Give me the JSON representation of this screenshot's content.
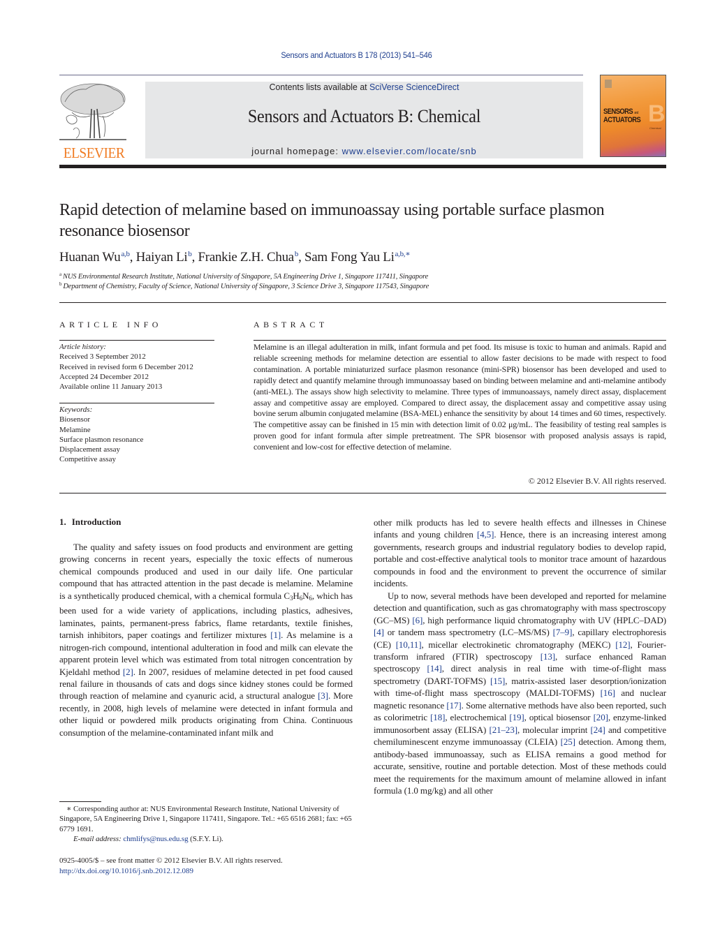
{
  "header": {
    "citation": "Sensors and Actuators B 178 (2013) 541–546",
    "contents_prefix": "Contents lists available at ",
    "contents_link": "SciVerse ScienceDirect",
    "journal_name": "Sensors and Actuators B: Chemical",
    "homepage_prefix": "journal homepage: ",
    "homepage_link": "www.elsevier.com/locate/snb",
    "publisher_logo_text": "ELSEVIER",
    "cover": {
      "line1": "SENSORS",
      "and": "and",
      "line2": "ACTUATORS",
      "letter": "B",
      "sub": "Chemical"
    }
  },
  "article": {
    "title": "Rapid detection of melamine based on immunoassay using portable surface plasmon resonance biosensor",
    "authors": [
      {
        "name": "Huanan Wu",
        "sup": "a,b"
      },
      {
        "name": "Haiyan Li",
        "sup": "b"
      },
      {
        "name": "Frankie Z.H. Chua",
        "sup": "b"
      },
      {
        "name": "Sam Fong Yau Li",
        "sup": "a,b,∗"
      }
    ],
    "affiliations": [
      {
        "key": "a",
        "text": "NUS Environmental Research Institute, National University of Singapore, 5A Engineering Drive 1, Singapore 117411, Singapore"
      },
      {
        "key": "b",
        "text": "Department of Chemistry, Faculty of Science, National University of Singapore, 3 Science Drive 3, Singapore 117543, Singapore"
      }
    ]
  },
  "article_info": {
    "heading": "ARTICLE INFO",
    "history_label": "Article history:",
    "history": [
      "Received 3 September 2012",
      "Received in revised form 6 December 2012",
      "Accepted 24 December 2012",
      "Available online 11 January 2013"
    ],
    "keywords_label": "Keywords:",
    "keywords": [
      "Biosensor",
      "Melamine",
      "Surface plasmon resonance",
      "Displacement assay",
      "Competitive assay"
    ]
  },
  "abstract": {
    "heading": "ABSTRACT",
    "text": "Melamine is an illegal adulteration in milk, infant formula and pet food. Its misuse is toxic to human and animals. Rapid and reliable screening methods for melamine detection are essential to allow faster decisions to be made with respect to food contamination. A portable miniaturized surface plasmon resonance (mini-SPR) biosensor has been developed and used to rapidly detect and quantify melamine through immunoassay based on binding between melamine and anti-melamine antibody (anti-MEL). The assays show high selectivity to melamine. Three types of immunoassays, namely direct assay, displacement assay and competitive assay are employed. Compared to direct assay, the displacement assay and competitive assay using bovine serum albumin conjugated melamine (BSA-MEL) enhance the sensitivity by about 14 times and 60 times, respectively. The competitive assay can be finished in 15 min with detection limit of 0.02 μg/mL. The feasibility of testing real samples is proven good for infant formula after simple pretreatment. The SPR biosensor with proposed analysis assays is rapid, convenient and low-cost for effective detection of melamine.",
    "copyright": "© 2012 Elsevier B.V. All rights reserved."
  },
  "introduction": {
    "number": "1.",
    "heading": "Introduction",
    "left_column": {
      "p1_a": "The quality and safety issues on food products and environment are getting growing concerns in recent years, especially the toxic effects of numerous chemical compounds produced and used in our daily life. One particular compound that has attracted attention in the past decade is melamine. Melamine is a synthetically produced chemical, with a chemical formula ",
      "formula": {
        "c": "C",
        "c_n": "3",
        "h": "H",
        "h_n": "6",
        "n": "N",
        "n_n": "6"
      },
      "p1_b": ", which has been used for a wide variety of applications, including plastics, adhesives, laminates, paints, permanent-press fabrics, flame retardants, textile finishes, tarnish inhibitors, paper coatings and fertilizer mixtures ",
      "ref1": "[1]",
      "p1_c": ". As melamine is a nitrogen-rich compound, intentional adulteration in food and milk can elevate the apparent protein level which was estimated from total nitrogen concentration by Kjeldahl method ",
      "ref2": "[2]",
      "p1_d": ". In 2007, residues of melamine detected in pet food caused renal failure in thousands of cats and dogs since kidney stones could be formed through reaction of melamine and cyanuric acid, a structural analogue ",
      "ref3": "[3]",
      "p1_e": ". More recently, in 2008, high levels of melamine were detected in infant formula and other liquid or powdered milk products originating from China. Continuous consumption of the melamine-contaminated infant milk and"
    },
    "right_column": {
      "p1_a": "other milk products has led to severe health effects and illnesses in Chinese infants and young children ",
      "ref45": "[4,5]",
      "p1_b": ". Hence, there is an increasing interest among governments, research groups and industrial regulatory bodies to develop rapid, portable and cost-effective analytical tools to monitor trace amount of hazardous compounds in food and the environment to prevent the occurrence of similar incidents.",
      "p2_segments": [
        {
          "t": "Up to now, several methods have been developed and reported for melamine detection and quantification, such as gas chromatography with mass spectroscopy (GC–MS) "
        },
        {
          "r": "[6]"
        },
        {
          "t": ", high performance liquid chromatography with UV (HPLC–DAD) "
        },
        {
          "r": "[4]"
        },
        {
          "t": " or tandem mass spectrometry (LC–MS/MS) "
        },
        {
          "r": "[7–9]"
        },
        {
          "t": ", capillary electrophoresis (CE) "
        },
        {
          "r": "[10,11]"
        },
        {
          "t": ", micellar electrokinetic chromatography (MEKC) "
        },
        {
          "r": "[12]"
        },
        {
          "t": ", Fourier-transform infrared (FTIR) spectroscopy "
        },
        {
          "r": "[13]"
        },
        {
          "t": ", surface enhanced Raman spectroscopy "
        },
        {
          "r": "[14]"
        },
        {
          "t": ", direct analysis in real time with time-of-flight mass spectrometry (DART-TOFMS) "
        },
        {
          "r": "[15]"
        },
        {
          "t": ", matrix-assisted laser desorption/ionization with time-of-flight mass spectroscopy (MALDI-TOFMS) "
        },
        {
          "r": "[16]"
        },
        {
          "t": " and nuclear magnetic resonance "
        },
        {
          "r": "[17]"
        },
        {
          "t": ". Some alternative methods have also been reported, such as colorimetric "
        },
        {
          "r": "[18]"
        },
        {
          "t": ", electrochemical "
        },
        {
          "r": "[19]"
        },
        {
          "t": ", optical biosensor "
        },
        {
          "r": "[20]"
        },
        {
          "t": ", enzyme-linked immunosorbent assay (ELISA) "
        },
        {
          "r": "[21–23]"
        },
        {
          "t": ", molecular imprint "
        },
        {
          "r": "[24]"
        },
        {
          "t": " and competitive chemiluminescent enzyme immunoassay (CLEIA) "
        },
        {
          "r": "[25]"
        },
        {
          "t": " detection. Among them, antibody-based immunoassay, such as ELISA remains a good method for accurate, sensitive, routine and portable detection. Most of these methods could meet the requirements for the maximum amount of melamine allowed in infant formula (1.0 mg/kg) and all other"
        }
      ]
    }
  },
  "footnote": {
    "marker": "∗",
    "text": "Corresponding author at: NUS Environmental Research Institute, National University of Singapore, 5A Engineering Drive 1, Singapore 117411, Singapore. Tel.: +65 6516 2681; fax: +65 6779 1691.",
    "email_label": "E-mail address: ",
    "email": "chmlifys@nus.edu.sg",
    "email_suffix": " (S.F.Y. Li)."
  },
  "front_matter": {
    "issn_line": "0925-4005/$ – see front matter © 2012 Elsevier B.V. All rights reserved.",
    "doi": "http://dx.doi.org/10.1016/j.snb.2012.12.089"
  }
}
